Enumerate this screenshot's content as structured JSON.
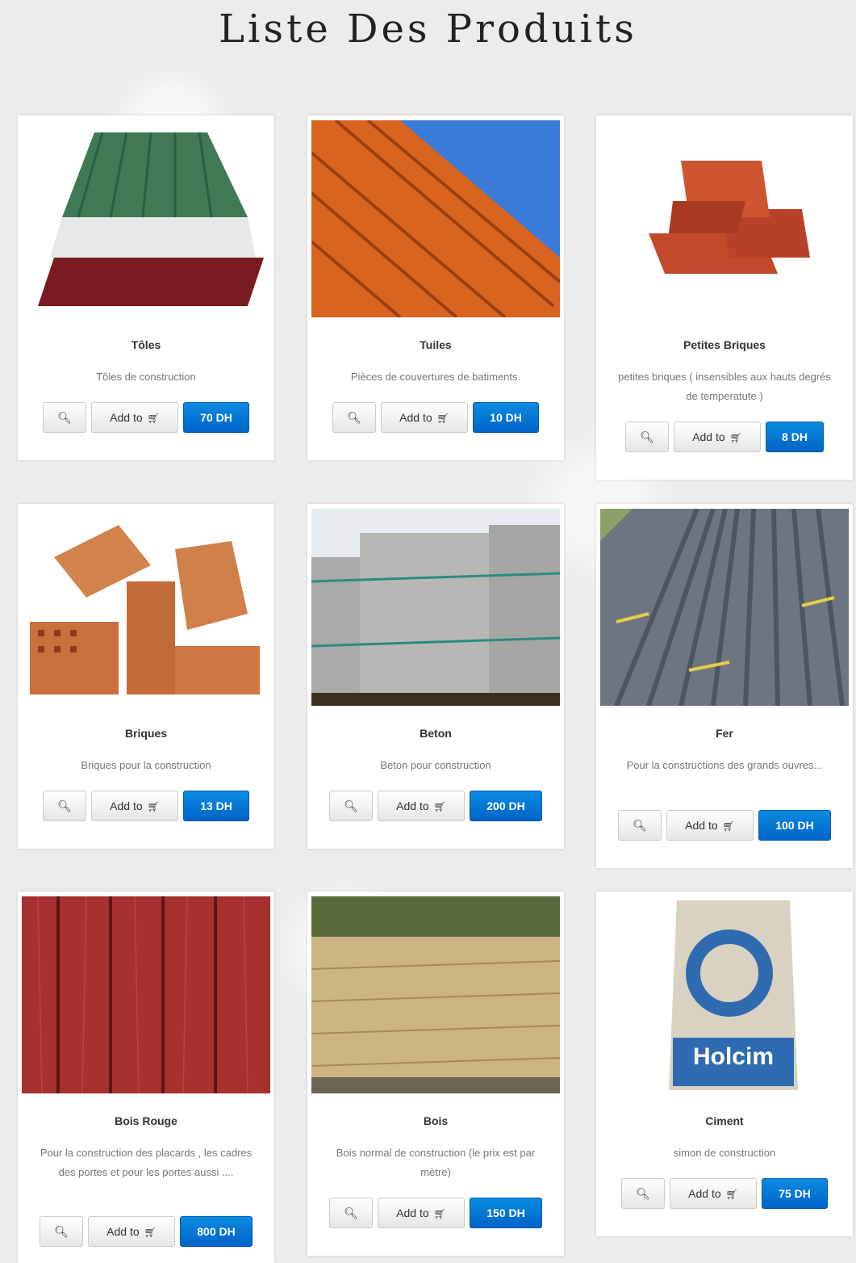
{
  "page_title": "Liste Des Produits",
  "view_icon": "search-icon",
  "cart_icon": "cart-icon",
  "products": [
    {
      "name": "Tôles",
      "description": "Tôles de construction",
      "add_label": "Add to",
      "price": "70 DH"
    },
    {
      "name": "Tuiles",
      "description": "Pièces de couvertures de batiments.",
      "add_label": "Add to",
      "price": "10 DH"
    },
    {
      "name": "Petites Briques",
      "description": "petites briques ( insensibles aux hauts degrés de temperatute )",
      "add_label": "Add to",
      "price": "8 DH"
    },
    {
      "name": "Briques",
      "description": "Briques pour la construction",
      "add_label": "Add to",
      "price": "13 DH"
    },
    {
      "name": "Beton",
      "description": "Beton pour construction",
      "add_label": "Add to",
      "price": "200 DH"
    },
    {
      "name": "Fer",
      "description": "Pour la constructions des grands ouvres...",
      "add_label": "Add to",
      "price": "100 DH"
    },
    {
      "name": "Bois Rouge",
      "description": "Pour la construction des placards , les cadres des portes et pour les portes aussi ....",
      "add_label": "Add to",
      "price": "800 DH"
    },
    {
      "name": "Bois",
      "description": "Bois normal de construction (le prix est par mètre)",
      "add_label": "Add to",
      "price": "150 DH"
    },
    {
      "name": "Ciment",
      "description": "simon de construction",
      "add_label": "Add to",
      "price": "75 DH"
    }
  ],
  "ciment_brand": "Holcim"
}
